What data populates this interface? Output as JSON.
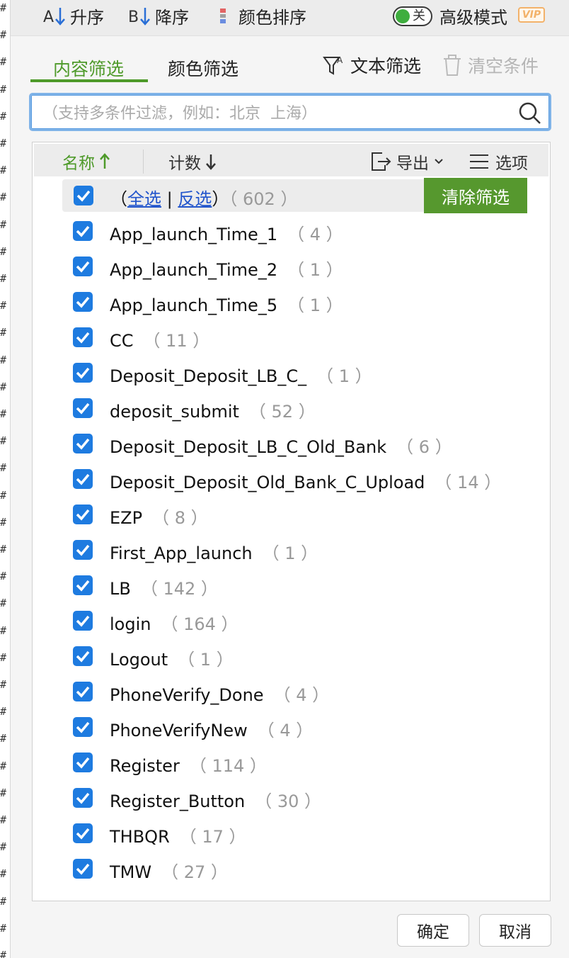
{
  "gutter_char": "#",
  "toolbar": {
    "sort_asc": "升序",
    "sort_desc": "降序",
    "color_sort": "颜色排序",
    "toggle_state": "关",
    "advanced_mode": "高级模式",
    "vip_badge": "VIP"
  },
  "tabs": {
    "content_filter": "内容筛选",
    "color_filter": "颜色筛选",
    "text_filter": "文本筛选",
    "clear_conditions": "清空条件"
  },
  "search": {
    "placeholder": "（支持多条件过滤，例如：北京  上海）",
    "value": ""
  },
  "list_header": {
    "name_col": "名称",
    "count_col": "计数",
    "export": "导出",
    "options": "选项"
  },
  "select_all": {
    "open": "（",
    "all": "全选",
    "sep": "|",
    "invert": "反选",
    "close": "）",
    "count": "（ 602 ）",
    "clear_filter": "清除筛选"
  },
  "items": [
    {
      "label": "App_launch_Time_1",
      "count": "（ 4 ）"
    },
    {
      "label": "App_launch_Time_2",
      "count": "（ 1 ）"
    },
    {
      "label": "App_launch_Time_5",
      "count": "（ 1 ）"
    },
    {
      "label": "CC",
      "count": "（ 11 ）"
    },
    {
      "label": "Deposit_Deposit_LB_C_",
      "count": "（ 1 ）"
    },
    {
      "label": "deposit_submit",
      "count": "（ 52 ）"
    },
    {
      "label": "Deposit_Deposit_LB_C_Old_Bank",
      "count": "（ 6 ）"
    },
    {
      "label": "Deposit_Deposit_Old_Bank_C_Upload",
      "count": "（ 14 ）"
    },
    {
      "label": "EZP",
      "count": "（ 8 ）"
    },
    {
      "label": "First_App_launch",
      "count": "（ 1 ）"
    },
    {
      "label": "LB",
      "count": "（ 142 ）"
    },
    {
      "label": "login",
      "count": "（ 164 ）"
    },
    {
      "label": "Logout",
      "count": "（ 1 ）"
    },
    {
      "label": "PhoneVerify_Done",
      "count": "（ 4 ）"
    },
    {
      "label": "PhoneVerifyNew",
      "count": "（ 4 ）"
    },
    {
      "label": "Register",
      "count": "（ 114 ）"
    },
    {
      "label": "Register_Button",
      "count": "（ 30 ）"
    },
    {
      "label": "THBQR",
      "count": "（ 17 ）"
    },
    {
      "label": "TMW",
      "count": "（ 27 ）"
    }
  ],
  "footer": {
    "ok": "确定",
    "cancel": "取消"
  },
  "colors": {
    "accent_green": "#4e9a2a",
    "checkbox_blue": "#1e7be0",
    "link_blue": "#2255cc"
  }
}
